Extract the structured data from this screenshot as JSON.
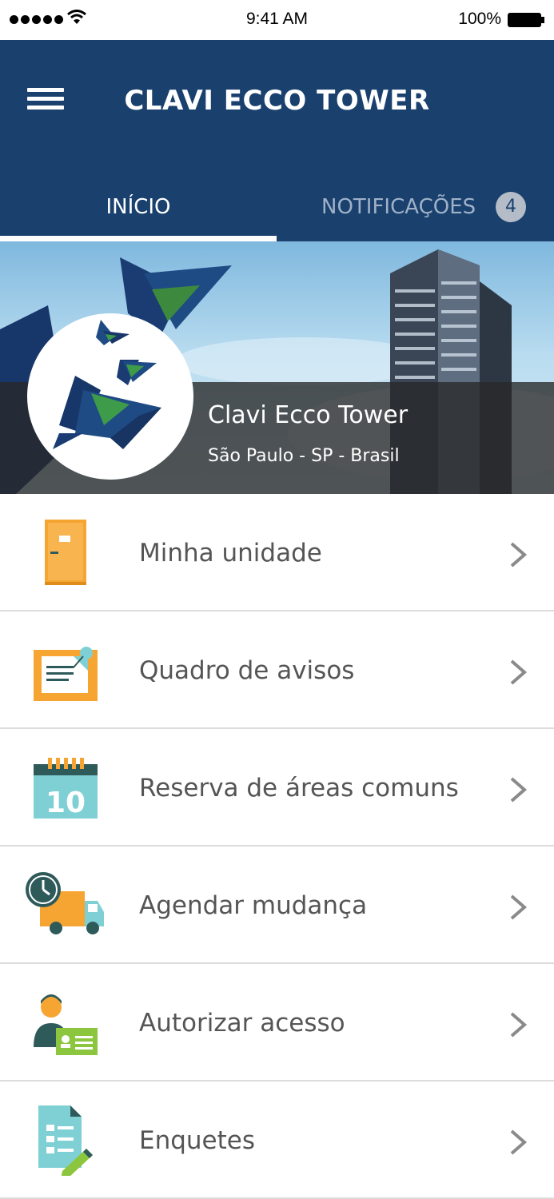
{
  "status_bar": {
    "time": "9:41 AM",
    "battery": "100%"
  },
  "header": {
    "title": "CLAVI ECCO TOWER",
    "menu_icon": "hamburger-menu-icon"
  },
  "tabs": [
    {
      "label": "INÍCIO",
      "active": true
    },
    {
      "label": "NOTIFICAÇÕES",
      "active": false,
      "badge": "4"
    }
  ],
  "banner": {
    "name": "Clavi Ecco Tower",
    "location": "São Paulo - SP - Brasil"
  },
  "menu": [
    {
      "label": "Minha unidade",
      "icon": "door-icon"
    },
    {
      "label": "Quadro de avisos",
      "icon": "notice-board-icon"
    },
    {
      "label": "Reserva de áreas comuns",
      "icon": "calendar-icon",
      "icon_text": "10"
    },
    {
      "label": "Agendar mudança",
      "icon": "moving-truck-icon"
    },
    {
      "label": "Autorizar acesso",
      "icon": "access-card-icon"
    },
    {
      "label": "Enquetes",
      "icon": "survey-icon"
    }
  ],
  "colors": {
    "header_bg": "#1a406e",
    "orange": "#f6a532",
    "teal": "#7fd0d4",
    "dark_teal": "#2f5a5a",
    "green": "#8cc63f"
  }
}
